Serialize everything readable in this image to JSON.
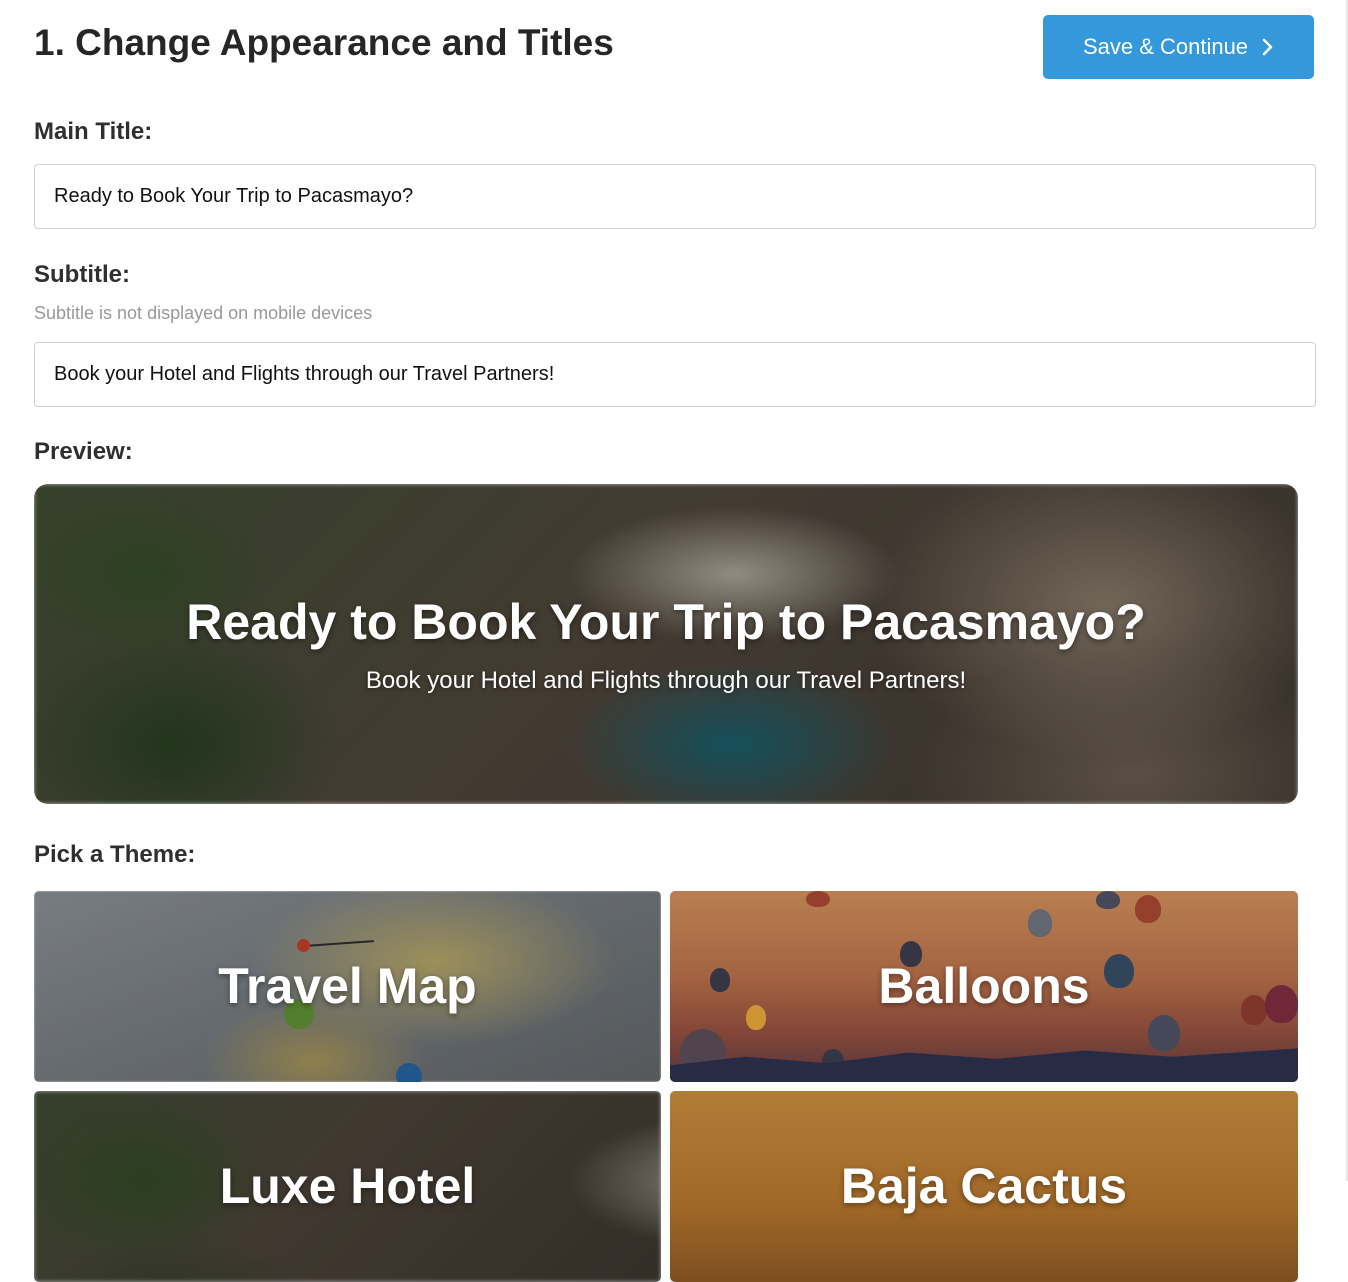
{
  "header": {
    "title": "1. Change Appearance and Titles",
    "save_label": "Save & Continue"
  },
  "main_title": {
    "label": "Main Title:",
    "value": "Ready to Book Your Trip to Pacasmayo?"
  },
  "subtitle": {
    "label": "Subtitle:",
    "hint": "Subtitle is not displayed on mobile devices",
    "value": "Book your Hotel and Flights through our Travel Partners!"
  },
  "preview": {
    "label": "Preview:",
    "title": "Ready to Book Your Trip to Pacasmayo?",
    "subtitle": "Book your Hotel and Flights through our Travel Partners!"
  },
  "themes": {
    "label": "Pick a Theme:",
    "items": [
      {
        "label": "Travel Map"
      },
      {
        "label": "Balloons"
      },
      {
        "label": "Luxe Hotel"
      },
      {
        "label": "Baja Cactus"
      }
    ]
  },
  "colors": {
    "accent": "#3498db"
  }
}
